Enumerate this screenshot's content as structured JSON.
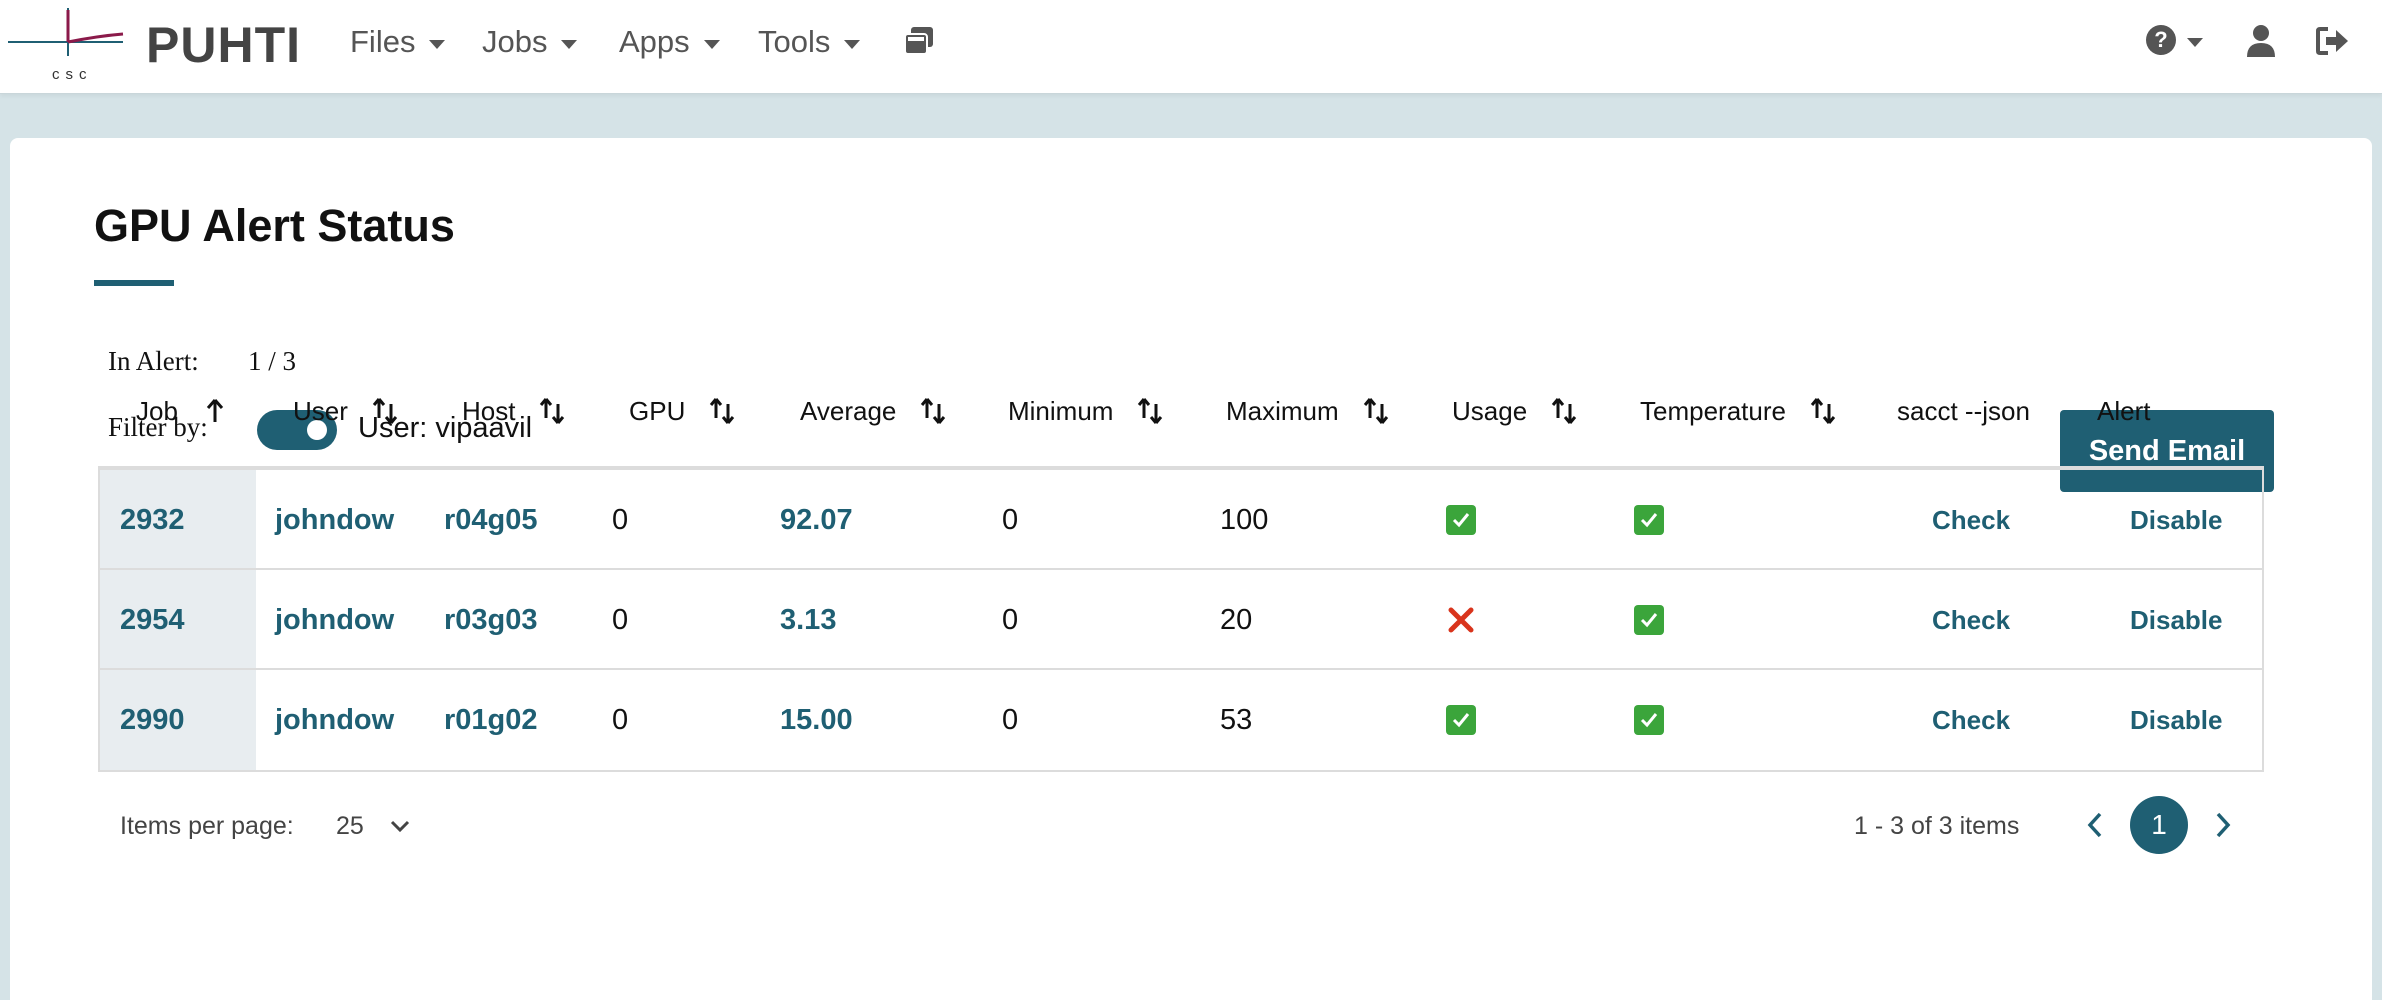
{
  "brand": {
    "name": "PUHTI",
    "logo_text": "csc"
  },
  "nav": {
    "files": "Files",
    "jobs": "Jobs",
    "apps": "Apps",
    "tools": "Tools"
  },
  "page": {
    "title": "GPU Alert Status"
  },
  "summary": {
    "in_alert_label": "In Alert:",
    "in_alert_value": "1 / 3",
    "filter_label": "Filter by:",
    "filter_toggle_text": "User: vipaavil",
    "filter_toggle_on": true
  },
  "send_email_label": "Send Email",
  "table": {
    "columns": [
      "Job",
      "User",
      "Host",
      "GPU",
      "Average",
      "Minimum",
      "Maximum",
      "Usage",
      "Temperature",
      "sacct --json",
      "Alert"
    ],
    "rows": [
      {
        "job": "2932",
        "user": "johndow",
        "host": "r04g05",
        "gpu": "0",
        "average": "92.07",
        "minimum": "0",
        "maximum": "100",
        "usage_ok": true,
        "temperature_ok": true,
        "sacct": "Check",
        "alert": "Disable"
      },
      {
        "job": "2954",
        "user": "johndow",
        "host": "r03g03",
        "gpu": "0",
        "average": "3.13",
        "minimum": "0",
        "maximum": "20",
        "usage_ok": false,
        "temperature_ok": true,
        "sacct": "Check",
        "alert": "Disable"
      },
      {
        "job": "2990",
        "user": "johndow",
        "host": "r01g02",
        "gpu": "0",
        "average": "15.00",
        "minimum": "0",
        "maximum": "53",
        "usage_ok": true,
        "temperature_ok": true,
        "sacct": "Check",
        "alert": "Disable"
      }
    ]
  },
  "pagination": {
    "items_per_page_label": "Items per page:",
    "items_per_page_value": "25",
    "range_text": "1 - 3 of 3 items",
    "current_page": "1"
  },
  "colors": {
    "accent": "#1f5f73",
    "background": "#d5e3e7",
    "ok": "#3ba53b",
    "error": "#d9341c"
  }
}
